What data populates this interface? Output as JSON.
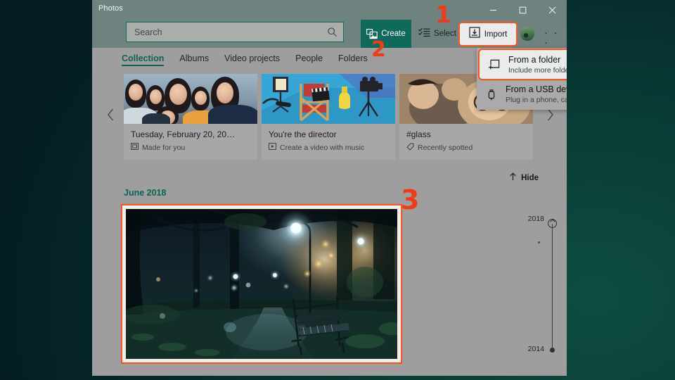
{
  "window": {
    "app_title": "Photos",
    "controls": [
      {
        "name": "minimize",
        "glyph": "minimize-icon"
      },
      {
        "name": "maximize",
        "glyph": "maximize-icon"
      },
      {
        "name": "close",
        "glyph": "close-icon"
      }
    ]
  },
  "search": {
    "placeholder": "Search",
    "value": "Search",
    "icon": "search-icon"
  },
  "commandbar": {
    "create_label": "Create",
    "select_label": "Select",
    "import_label": "Import",
    "more_label": "· · ·",
    "accent_green": "#0f6a5b",
    "highlight_orange": "#f05a28"
  },
  "tabs": [
    {
      "label": "Collection",
      "active": true
    },
    {
      "label": "Albums",
      "active": false
    },
    {
      "label": "Video projects",
      "active": false
    },
    {
      "label": "People",
      "active": false
    },
    {
      "label": "Folders",
      "active": false
    }
  ],
  "cards": [
    {
      "title": "Tuesday, February 20, 20…",
      "subtitle": "Made for you",
      "sub_icon": "memory-card-icon"
    },
    {
      "title": "You're the director",
      "subtitle": "Create a video with music",
      "sub_icon": "video-icon"
    },
    {
      "title": "#glass",
      "subtitle": "Recently spotted",
      "sub_icon": "tag-icon"
    }
  ],
  "carousel": {
    "prev_icon": "chevron-left-icon",
    "next_icon": "chevron-right-icon"
  },
  "hide": {
    "label": "Hide",
    "icon": "arrow-up-icon"
  },
  "month_group": {
    "label": "June 2018"
  },
  "import_menu": {
    "items": [
      {
        "title": "From a folder",
        "subtitle": "Include more folders in your collection",
        "icon": "folder-add-icon",
        "highlighted": true
      },
      {
        "title": "From a USB device",
        "subtitle": "Plug in a phone, camera, or another device",
        "icon": "usb-icon",
        "highlighted": false
      }
    ]
  },
  "timeline": {
    "year_top": "2018",
    "year_bottom": "2014"
  },
  "annotations": [
    {
      "label": "1",
      "target": "import-button"
    },
    {
      "label": "2",
      "target": "from-a-folder-menu-item"
    },
    {
      "label": "3",
      "target": "selected-photo"
    }
  ]
}
